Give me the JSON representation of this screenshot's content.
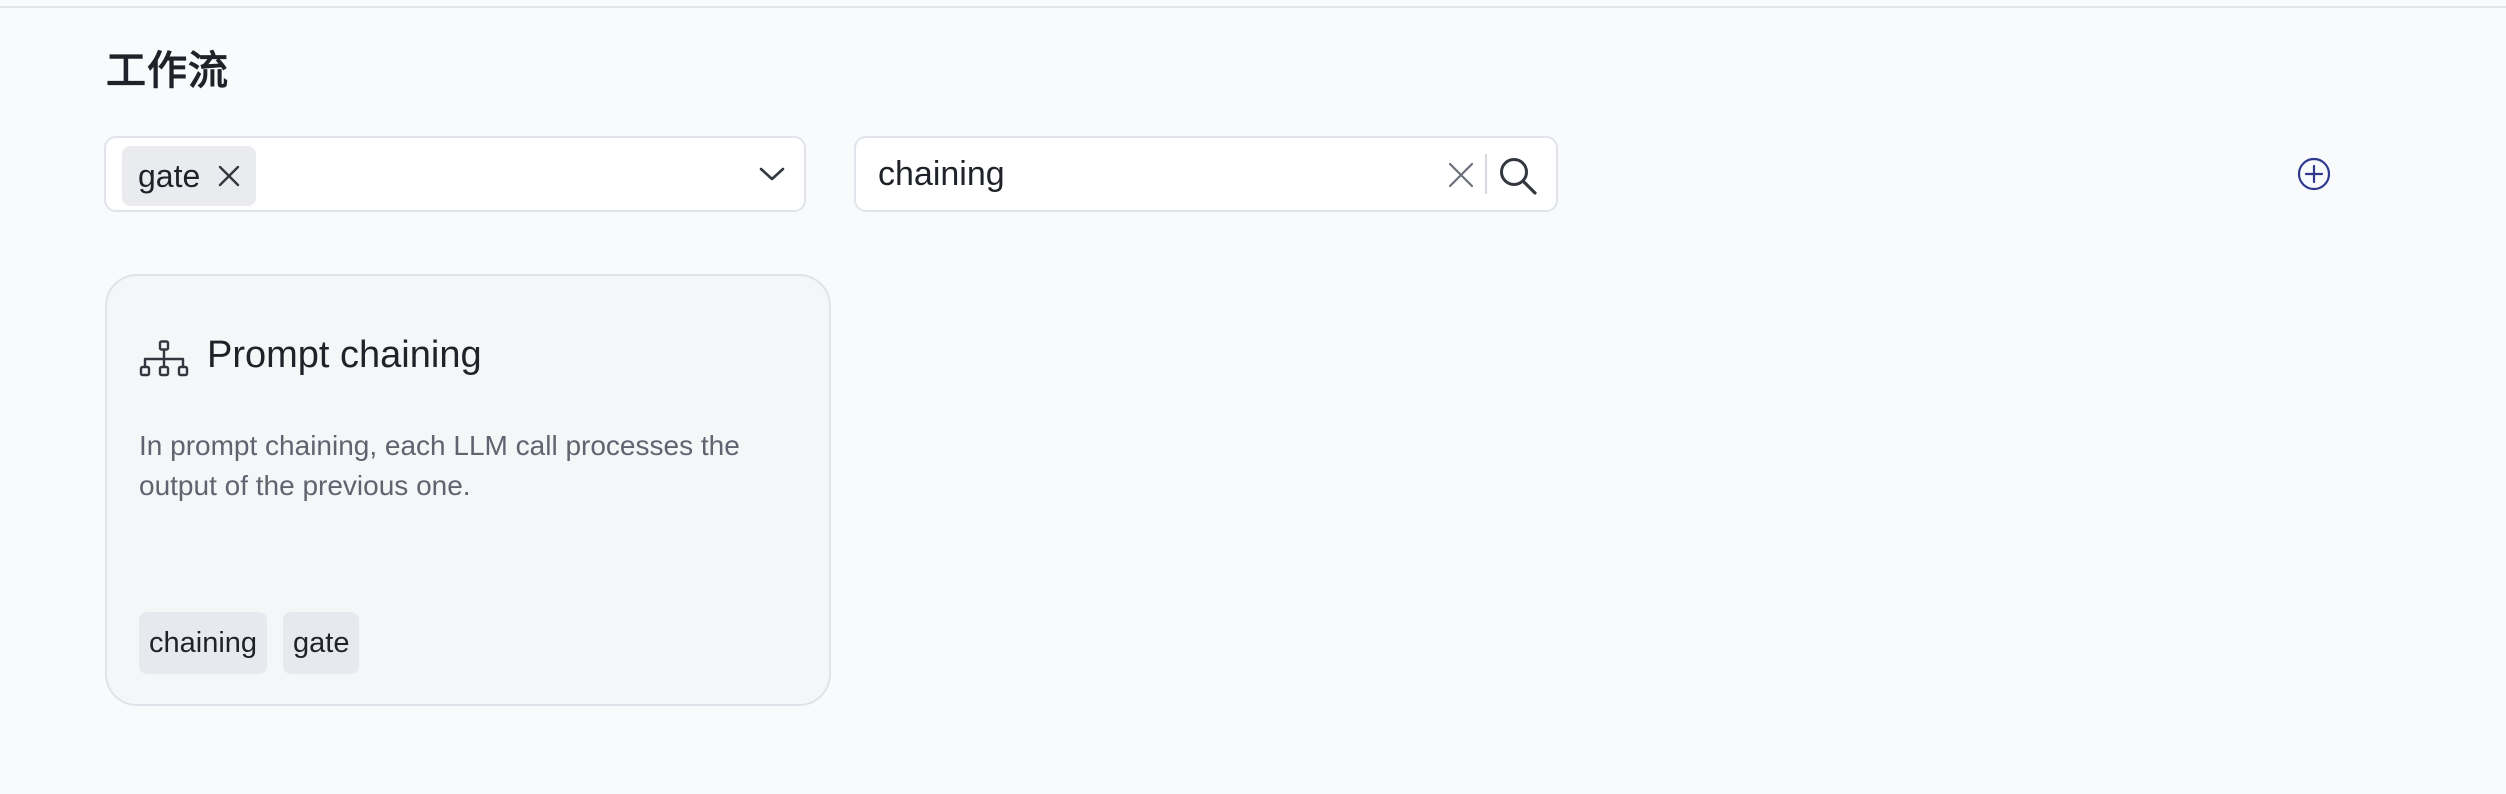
{
  "page": {
    "title": "工作流"
  },
  "filter": {
    "selected_tags": [
      {
        "label": "gate",
        "icon": "close-icon"
      }
    ],
    "dropdown_icon": "chevron-down-icon"
  },
  "search": {
    "value": "chaining",
    "clear_icon": "close-icon",
    "search_icon": "search-icon"
  },
  "actions": {
    "add_icon": "plus-circle-icon"
  },
  "workflows": [
    {
      "icon": "hierarchy-icon",
      "title": "Prompt chaining",
      "description": "In prompt chaining, each LLM call processes the output of the previous one.",
      "tags": [
        "chaining",
        "gate"
      ]
    }
  ],
  "colors": {
    "background": "#f9fafc",
    "accent": "#2f3a8f",
    "chip_bg": "#e9ebef"
  }
}
